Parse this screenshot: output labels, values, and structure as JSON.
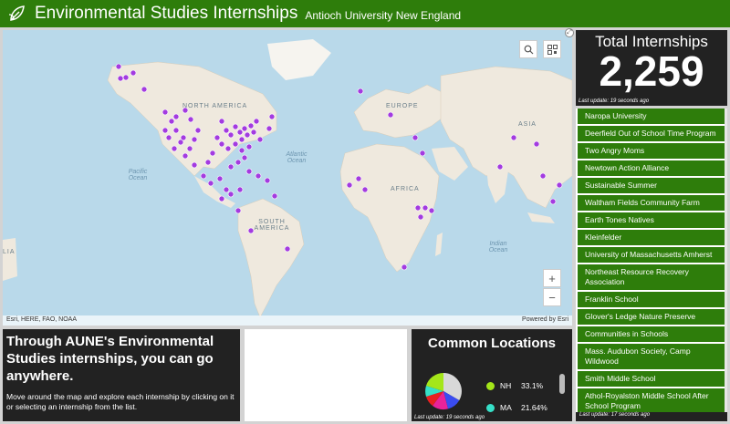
{
  "header": {
    "title": "Environmental Studies Internships",
    "subtitle": "Antioch University New England",
    "logo_icon": "leaf-icon"
  },
  "map": {
    "labels": {
      "north_america": "NORTH AMERICA",
      "europe": "EUROPE",
      "asia": "ASIA",
      "africa": "AFRICA",
      "south_america": "SOUTH AMERICA",
      "atlantic": "Atlantic Ocean",
      "pacific": "Pacific Ocean",
      "indian": "Indian Ocean",
      "lia": "LIA"
    },
    "attribution_left": "Esri, HERE, FAO, NOAA",
    "attribution_right": "Powered by Esri",
    "zoom_in": "+",
    "zoom_out": "−",
    "marker_color": "#a33be0"
  },
  "total": {
    "title": "Total Internships",
    "value": "2,259",
    "last_update": "Last update: 19 seconds ago"
  },
  "list": {
    "items": [
      "Naropa University",
      "Deerfield Out of School Time Program",
      "Two Angry Moms",
      "Newtown Action Alliance",
      "Sustainable Summer",
      "Waltham Fields Community Farm",
      "Earth Tones Natives",
      "Kleinfelder",
      "University of Massachusetts Amherst",
      "Northeast Resource Recovery Association",
      "Franklin School",
      "Glover's Ledge Nature Preserve",
      "Communities in Schools",
      "Mass. Audubon Society, Camp Wildwood",
      "Smith Middle School",
      "Athol-Royalston Middle School After School Program"
    ],
    "last_update": "Last update: 17 seconds ago"
  },
  "promo": {
    "heading": "Through AUNE's Environmental Studies internships, you can go anywhere.",
    "body": "Move around the map and explore each internship by clicking on it or selecting an internship from the list."
  },
  "common": {
    "title": "Common Locations",
    "locations": [
      {
        "name": "NH",
        "pct": "33.1%",
        "color": "#a4e619"
      },
      {
        "name": "MA",
        "pct": "21.64%",
        "color": "#36e0c8"
      }
    ],
    "last_update": "Last update: 19 seconds ago"
  }
}
